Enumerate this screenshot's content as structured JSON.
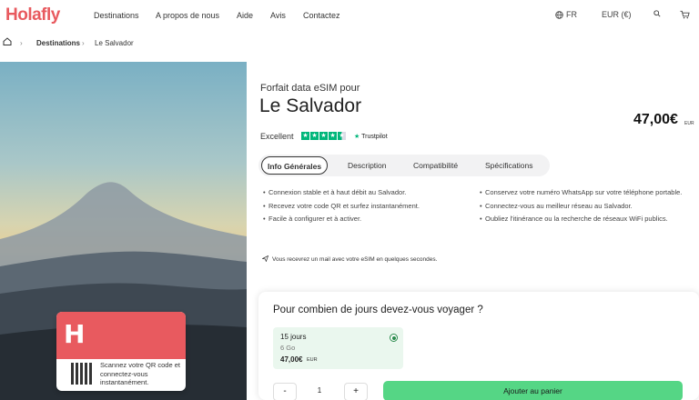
{
  "header": {
    "logo": "Holafly",
    "nav": [
      "Destinations",
      "A propos de nous",
      "Aide",
      "Avis",
      "Contactez"
    ],
    "language": "FR",
    "currency": "EUR (€)"
  },
  "breadcrumb": {
    "items": [
      "Destinations",
      "Le Salvador"
    ]
  },
  "product": {
    "pretitle": "Forfait data eSIM pour",
    "title": "Le Salvador",
    "price": "47,00€",
    "price_currency": "EUR",
    "rating_label": "Excellent",
    "trustpilot": "Trustpilot",
    "stars": 4.5
  },
  "tabs": [
    "Info Générales",
    "Description",
    "Compatibilité",
    "Spécifications"
  ],
  "bullets_left": [
    "Connexion stable et à haut débit au Salvador.",
    "Recevez votre code QR et surfez instantanément.",
    "Facile à configurer et à activer."
  ],
  "bullets_right": [
    "Conservez votre numéro WhatsApp sur votre téléphone portable.",
    "Connectez-vous au meilleur réseau au Salvador.",
    "Oubliez l'itinérance ou la recherche de réseaux WiFi publics."
  ],
  "mail_note": "Vous recevrez un mail avec votre eSIM en quelques secondes.",
  "card": {
    "logo": "H",
    "text": "Scannez votre QR code et connectez-vous instantanément."
  },
  "booking": {
    "question": "Pour combien de jours devez-vous voyager ?",
    "option": {
      "days": "15 jours",
      "data": "6 Go",
      "price": "47,00€",
      "currency": "EUR"
    },
    "quantity": "1",
    "minus": "-",
    "plus": "+",
    "add_to_cart": "Ajouter au panier"
  },
  "icons": {
    "home": "home-icon",
    "globe": "globe-icon",
    "search": "search-icon",
    "cart": "cart-icon",
    "send": "send-icon"
  },
  "colors": {
    "brand": "#e85a5f",
    "cta": "#55d685",
    "trustpilot": "#00b67a",
    "selected_option": "#eaf7ee"
  }
}
